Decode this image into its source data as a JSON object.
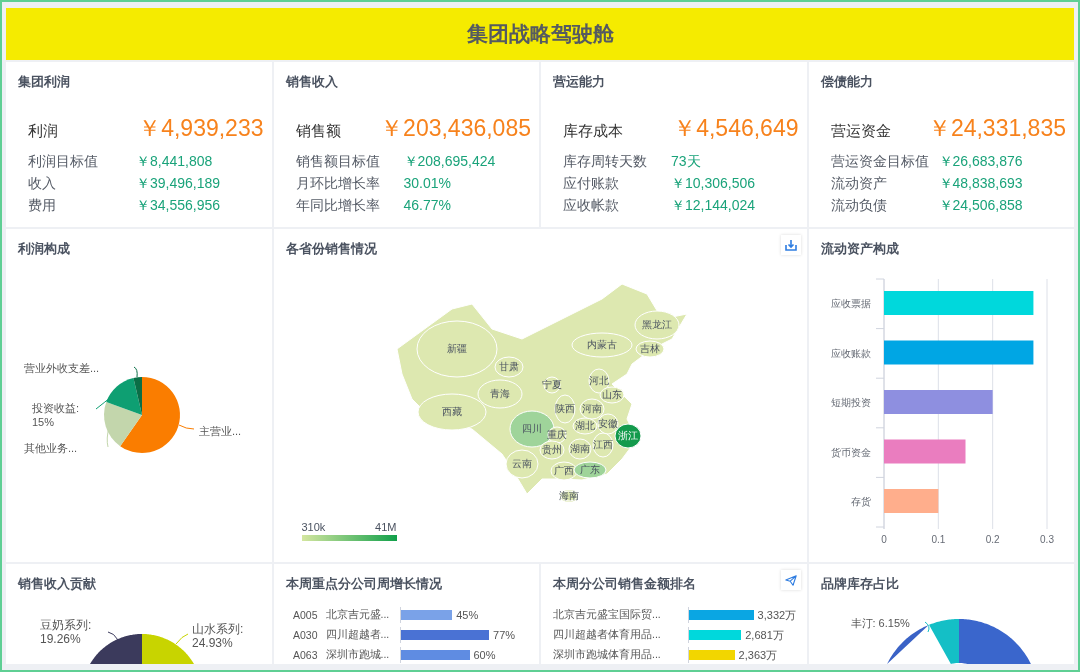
{
  "title": "集团战略驾驶舱",
  "kpis": [
    {
      "title": "集团利润",
      "main": {
        "label": "利润",
        "value": "￥4,939,233"
      },
      "rows": [
        {
          "label": "利润目标值",
          "value": "￥8,441,808"
        },
        {
          "label": "收入",
          "value": "￥39,496,189"
        },
        {
          "label": "费用",
          "value": "￥34,556,956"
        }
      ]
    },
    {
      "title": "销售收入",
      "main": {
        "label": "销售额",
        "value": "￥203,436,085"
      },
      "rows": [
        {
          "label": "销售额目标值",
          "value": "￥208,695,424"
        },
        {
          "label": "月环比增长率",
          "value": "30.01%"
        },
        {
          "label": "年同比增长率",
          "value": "46.77%"
        }
      ]
    },
    {
      "title": "营运能力",
      "main": {
        "label": "库存成本",
        "value": "￥4,546,649"
      },
      "rows": [
        {
          "label": "库存周转天数",
          "value": "73天"
        },
        {
          "label": "应付账款",
          "value": "￥10,306,506"
        },
        {
          "label": "应收帐款",
          "value": "￥12,144,024"
        }
      ]
    },
    {
      "title": "偿债能力",
      "main": {
        "label": "营运资金",
        "value": "￥24,331,835"
      },
      "rows": [
        {
          "label": "营运资金目标值",
          "value": "￥26,683,876"
        },
        {
          "label": "流动资产",
          "value": "￥48,838,693"
        },
        {
          "label": "流动负债",
          "value": "￥24,506,858"
        }
      ]
    }
  ],
  "profit_composition": {
    "title": "利润构成",
    "labels": [
      "营业外收支差...",
      "投资收益: 15%",
      "其他业务...",
      "主营业..."
    ]
  },
  "province_sales": {
    "title": "各省份销售情况",
    "provinces": [
      {
        "name": "新疆",
        "color": "#dde8b0"
      },
      {
        "name": "甘肃",
        "color": "#dde8b0"
      },
      {
        "name": "青海",
        "color": "#dde8b0"
      },
      {
        "name": "西藏",
        "color": "#dde8b0"
      },
      {
        "name": "四川",
        "color": "#9fd49a"
      },
      {
        "name": "宁夏",
        "color": "#dde8b0"
      },
      {
        "name": "内蒙古",
        "color": "#dde8b0"
      },
      {
        "name": "黑龙江",
        "color": "#dde8b0"
      },
      {
        "name": "吉林",
        "color": "#dde8b0"
      },
      {
        "name": "河北",
        "color": "#dde8b0"
      },
      {
        "name": "山东",
        "color": "#dde8b0"
      },
      {
        "name": "陕西",
        "color": "#dde8b0"
      },
      {
        "name": "河南",
        "color": "#dde8b0"
      },
      {
        "name": "湖北",
        "color": "#dde8b0"
      },
      {
        "name": "安徽",
        "color": "#dde8b0"
      },
      {
        "name": "重庆",
        "color": "#dde8b0"
      },
      {
        "name": "浙江",
        "color": "#139a4c"
      },
      {
        "name": "贵州",
        "color": "#dde8b0"
      },
      {
        "name": "湖南",
        "color": "#dde8b0"
      },
      {
        "name": "江西",
        "color": "#dde8b0"
      },
      {
        "name": "云南",
        "color": "#dde8b0"
      },
      {
        "name": "广西",
        "color": "#dde8b0"
      },
      {
        "name": "广东",
        "color": "#9fd49a"
      },
      {
        "name": "海南",
        "color": "#dde8b0"
      }
    ],
    "legend": {
      "min": "310k",
      "max": "41M"
    }
  },
  "current_assets": {
    "title": "流动资产构成",
    "chart_data": {
      "type": "bar",
      "orientation": "horizontal",
      "categories": [
        "应收票据",
        "应收账款",
        "短期投资",
        "货币资金",
        "存货"
      ],
      "values": [
        0.275,
        0.275,
        0.2,
        0.15,
        0.1
      ],
      "colors": [
        "#00d8dc",
        "#00a6e4",
        "#8e8fe0",
        "#ea7dbf",
        "#ffae8c"
      ],
      "xlim": [
        0,
        0.3
      ],
      "xticks": [
        0,
        0.1,
        0.2,
        0.3
      ]
    }
  },
  "sales_contribution": {
    "title": "销售收入贡献",
    "labels": [
      "豆奶系列: 19.26%",
      "山水系列: 24.93%"
    ]
  },
  "weekly_growth": {
    "title": "本周重点分公司周增长情况",
    "rows": [
      {
        "code": "A005",
        "name": "北京吉元盛...",
        "value": "45%",
        "level": 0.45,
        "color": "#7aa2e8"
      },
      {
        "code": "A030",
        "name": "四川超越者...",
        "value": "77%",
        "level": 0.77,
        "color": "#4a72d4"
      },
      {
        "code": "A063",
        "name": "深圳市跑城...",
        "value": "60%",
        "level": 0.6,
        "color": "#5f8ce2"
      }
    ]
  },
  "sales_ranking": {
    "title": "本周分公司销售金额排名",
    "rows": [
      {
        "name": "北京吉元盛宝国际贸...",
        "value": "3,332万",
        "level": 0.68,
        "color": "#0aa6e3"
      },
      {
        "name": "四川超越者体育用品...",
        "value": "2,681万",
        "level": 0.55,
        "color": "#00d8dc"
      },
      {
        "name": "深圳市跑城体育用品...",
        "value": "2,363万",
        "level": 0.48,
        "color": "#f2d600"
      }
    ]
  },
  "brand_inventory": {
    "title": "品牌库存占比",
    "labels": [
      "丰汀: 6.15%"
    ]
  }
}
